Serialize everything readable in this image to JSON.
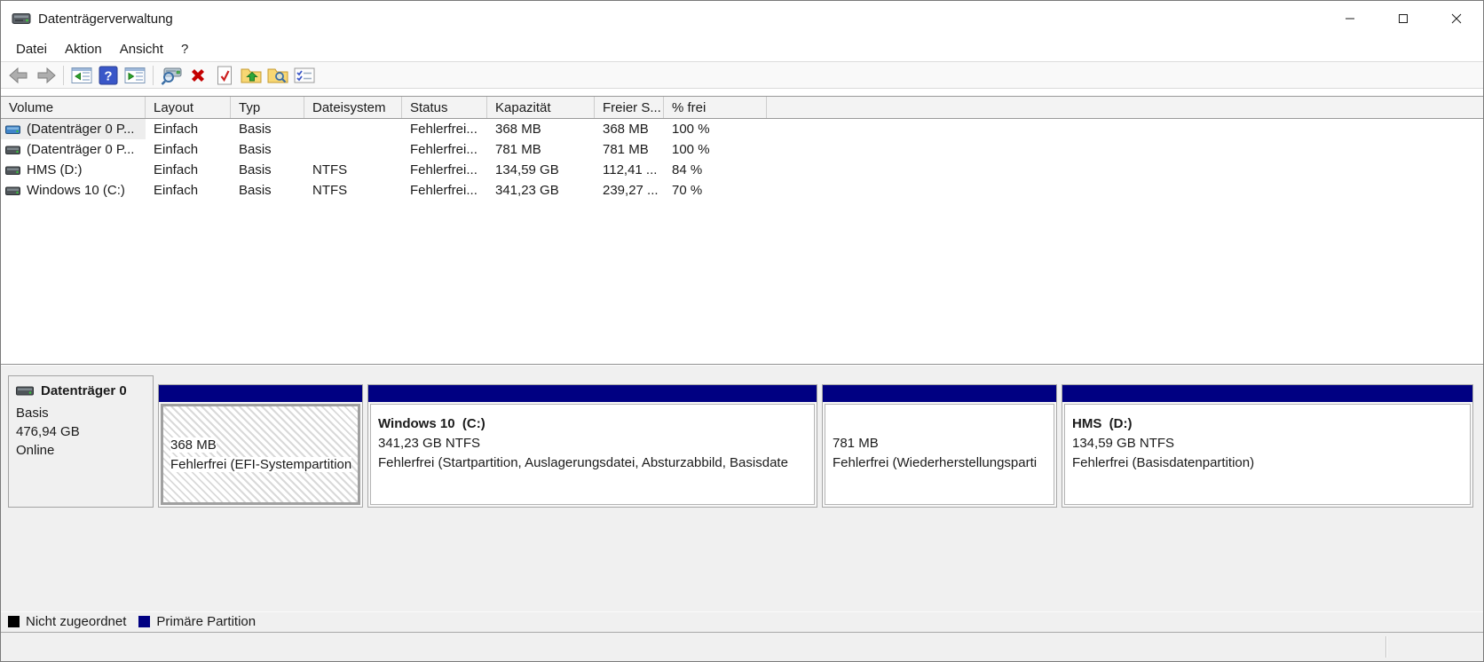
{
  "window": {
    "title": "Datenträgerverwaltung",
    "controls": {
      "minimize": "minimize-button",
      "maximize": "maximize-button",
      "close": "close-button"
    }
  },
  "menu": {
    "items": [
      "Datei",
      "Aktion",
      "Ansicht",
      "?"
    ]
  },
  "toolbar": {
    "icons": [
      "back-icon",
      "forward-icon",
      "console-tree-icon",
      "help-icon",
      "action-pane-icon",
      "rescan-disks-icon",
      "delete-icon",
      "check-document-icon",
      "folder-up-icon",
      "folder-search-icon",
      "properties-icon"
    ]
  },
  "volume_table": {
    "columns": [
      "Volume",
      "Layout",
      "Typ",
      "Dateisystem",
      "Status",
      "Kapazität",
      "Freier S...",
      "% frei"
    ],
    "rows": [
      {
        "icon": "volume-icon-blue",
        "selected": true,
        "cells": [
          "(Datenträger 0 P...",
          "Einfach",
          "Basis",
          "",
          "Fehlerfrei...",
          "368 MB",
          "368 MB",
          "100 %"
        ]
      },
      {
        "icon": "volume-icon",
        "selected": false,
        "cells": [
          "(Datenträger 0 P...",
          "Einfach",
          "Basis",
          "",
          "Fehlerfrei...",
          "781 MB",
          "781 MB",
          "100 %"
        ]
      },
      {
        "icon": "volume-icon",
        "selected": false,
        "cells": [
          "HMS (D:)",
          "Einfach",
          "Basis",
          "NTFS",
          "Fehlerfrei...",
          "134,59 GB",
          "112,41 ...",
          "84 %"
        ]
      },
      {
        "icon": "volume-icon",
        "selected": false,
        "cells": [
          "Windows 10 (C:)",
          "Einfach",
          "Basis",
          "NTFS",
          "Fehlerfrei...",
          "341,23 GB",
          "239,27 ...",
          "70 %"
        ]
      }
    ]
  },
  "disk_panel": {
    "name": "Datenträger 0",
    "type": "Basis",
    "capacity": "476,94 GB",
    "status": "Online"
  },
  "partitions": [
    {
      "name": "",
      "size_fs": "368 MB",
      "status": "Fehlerfrei (EFI-Systempartition",
      "selected": true
    },
    {
      "name": "Windows 10  (C:)",
      "size_fs": "341,23 GB NTFS",
      "status": "Fehlerfrei (Startpartition, Auslagerungsdatei, Absturzabbild, Basisdate",
      "selected": false
    },
    {
      "name": "",
      "size_fs": "781 MB",
      "status": "Fehlerfrei (Wiederherstellungsparti",
      "selected": false
    },
    {
      "name": "HMS  (D:)",
      "size_fs": "134,59 GB NTFS",
      "status": "Fehlerfrei (Basisdatenpartition)",
      "selected": false
    }
  ],
  "legend": {
    "items": [
      {
        "label": "Nicht zugeordnet",
        "color": "#000000"
      },
      {
        "label": "Primäre Partition",
        "color": "#000082"
      }
    ]
  },
  "colors": {
    "primary_partition": "#000082",
    "unallocated": "#000000",
    "selection_hatch": "#d9d9d9"
  }
}
